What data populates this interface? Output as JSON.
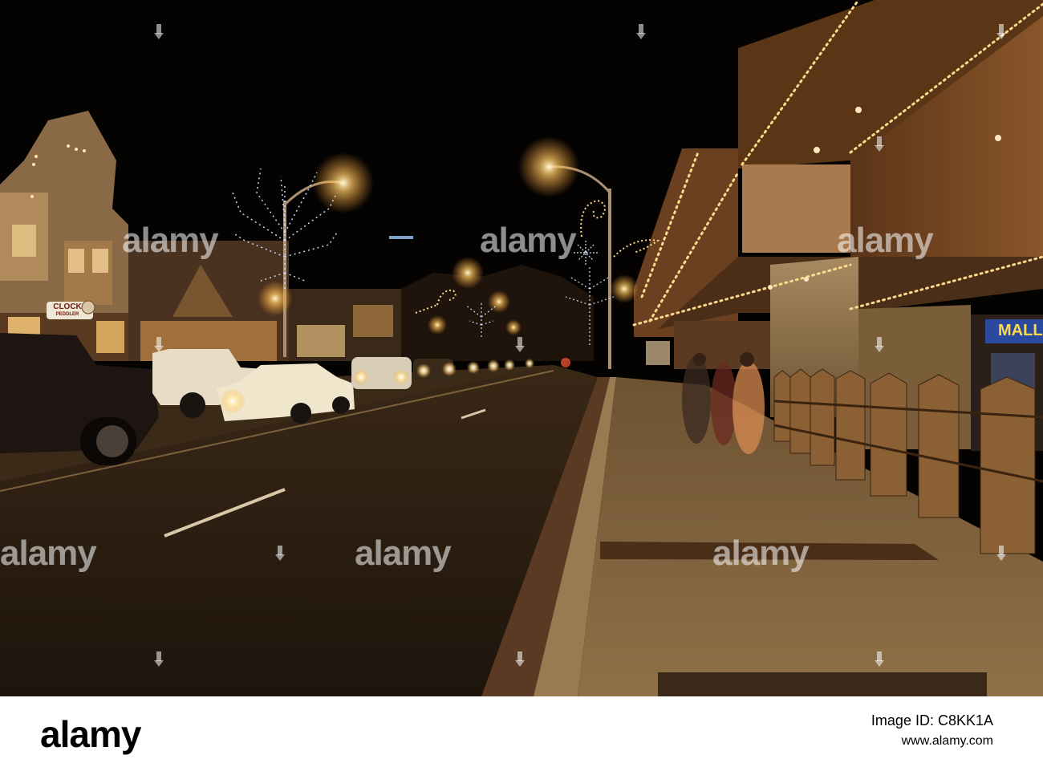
{
  "scene": {
    "description_none": "",
    "signs": {
      "clock_sign_line1": "CLOCK",
      "clock_sign_line2": "PEDDLER",
      "mall_sign": "MALL"
    }
  },
  "watermark": {
    "text": "alamy"
  },
  "footer": {
    "logo": "alamy",
    "image_id_label": "Image ID: C8KK1A",
    "site": "www.alamy.com"
  },
  "colors": {
    "sky": "#050302",
    "road": "#2a1d12",
    "sidewalk": "#8a6840",
    "wood_facade": "#7a4c26",
    "light_bulb": "#ffd98a",
    "blue_lights": "#cfe3ff"
  }
}
